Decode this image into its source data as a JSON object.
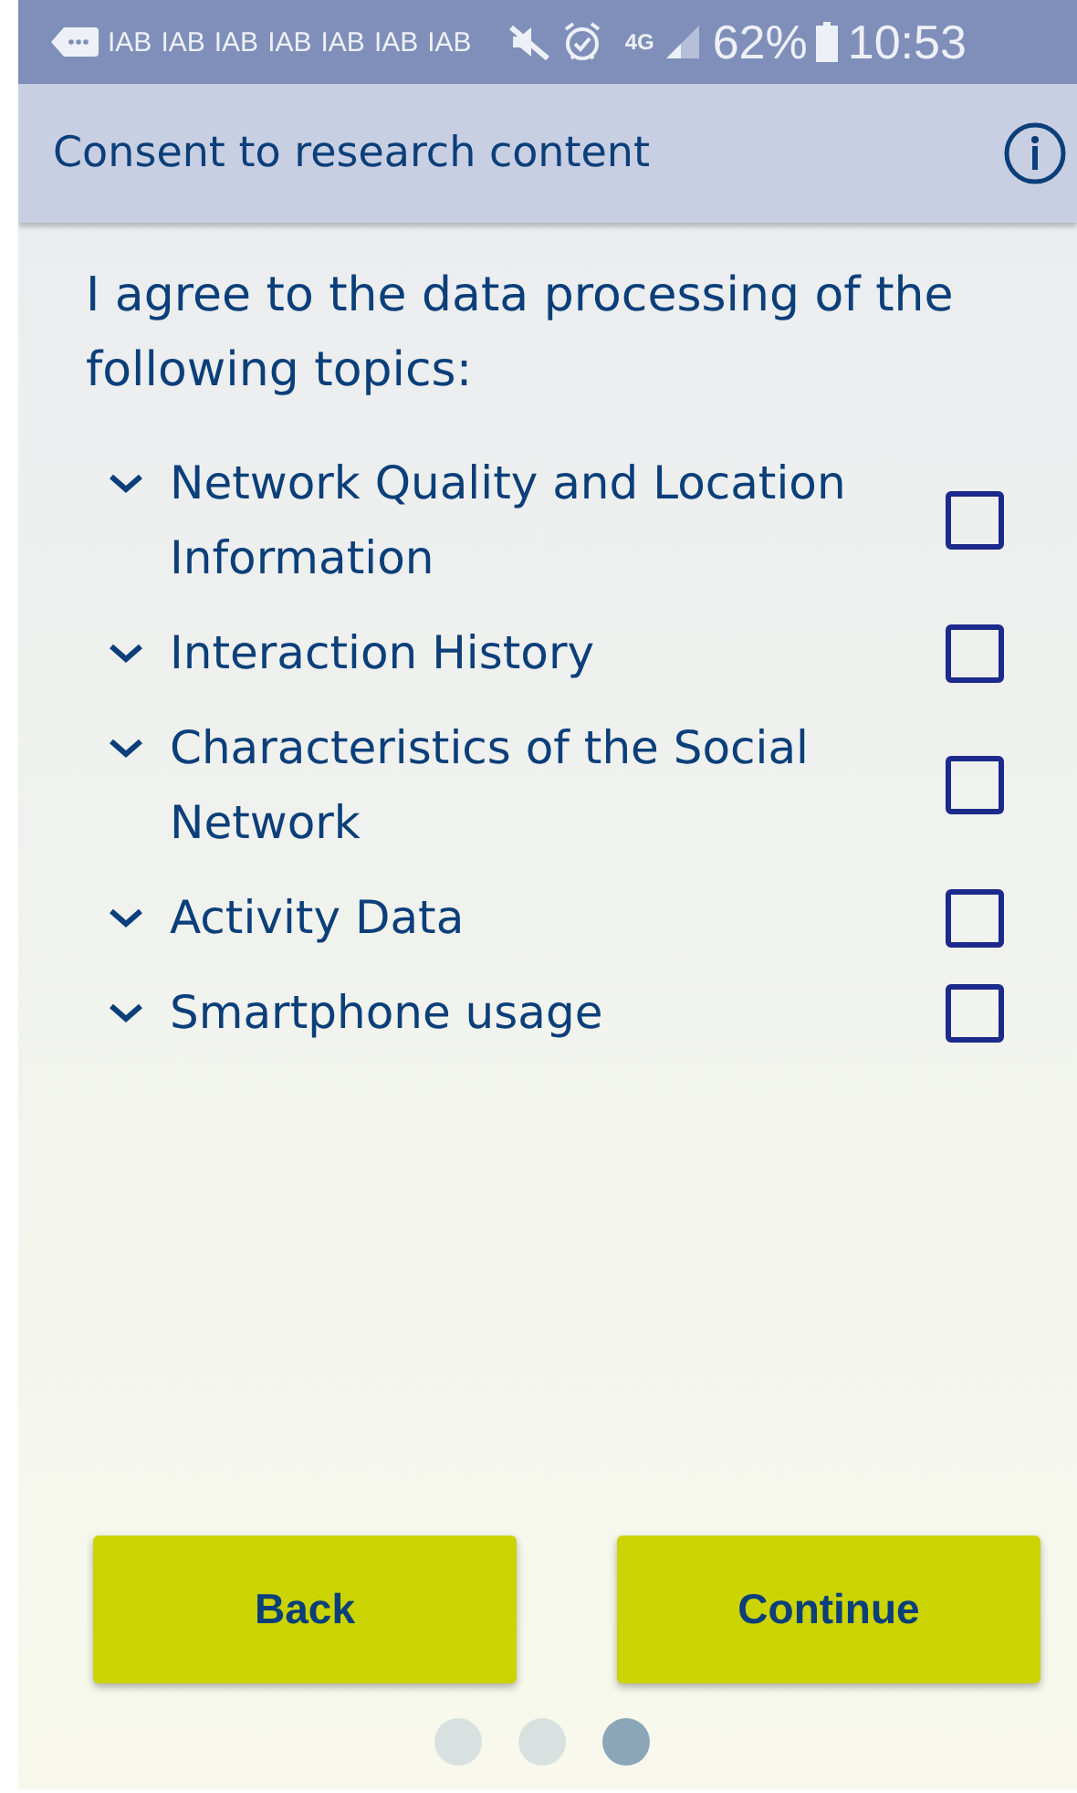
{
  "status_bar": {
    "notifications": [
      "IAB",
      "IAB",
      "IAB",
      "IAB",
      "IAB",
      "IAB",
      "IAB"
    ],
    "network": "4G",
    "battery": "62%",
    "time": "10:53"
  },
  "header": {
    "title": "Consent to research content"
  },
  "intro": "I agree to the data processing of the following topics:",
  "topics": [
    {
      "label": "Network Quality and Location Information",
      "expanded": false,
      "checked": false
    },
    {
      "label": "Interaction History",
      "expanded": false,
      "checked": false
    },
    {
      "label": "Characteristics of the Social Network",
      "expanded": false,
      "checked": false
    },
    {
      "label": "Activity Data",
      "expanded": false,
      "checked": false
    },
    {
      "label": "Smartphone usage",
      "expanded": false,
      "checked": false
    }
  ],
  "buttons": [
    {
      "label": "Back"
    },
    {
      "label": "Continue"
    }
  ],
  "pager": [
    {
      "selected": false
    },
    {
      "selected": false
    },
    {
      "selected": true
    }
  ]
}
